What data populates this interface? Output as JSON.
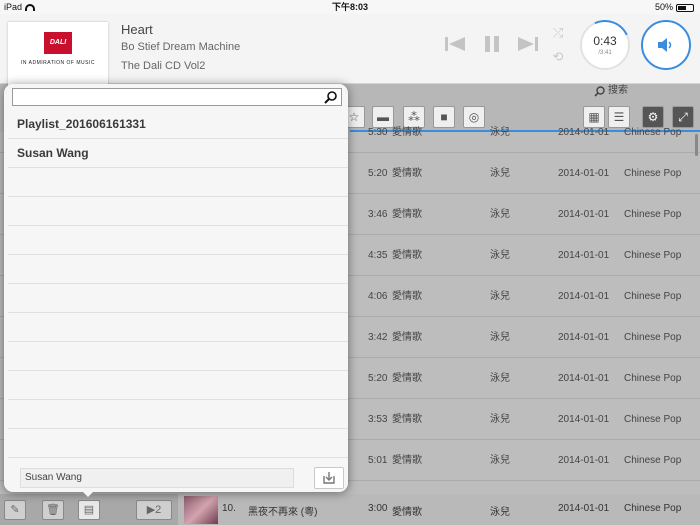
{
  "statusbar": {
    "device": "iPad",
    "time": "下午8:03",
    "battery": "50%"
  },
  "battery_level": 0.5,
  "nowplaying": {
    "title": "Heart",
    "artist": "Bo Stief Dream Machine",
    "album": "The Dali CD Vol2",
    "elapsed": "0:43",
    "total": "/3:41",
    "progress": 0.19
  },
  "logo": {
    "brand": "DALI",
    "tagline": "IN ADMIRATION OF MUSIC"
  },
  "toolbar": {
    "search_label": "搜索"
  },
  "popover": {
    "search_placeholder": "",
    "playlists": [
      {
        "name": "Playlist_201606161331"
      },
      {
        "name": "Susan Wang"
      },
      {
        "name": ""
      },
      {
        "name": ""
      },
      {
        "name": ""
      },
      {
        "name": ""
      },
      {
        "name": ""
      },
      {
        "name": ""
      },
      {
        "name": ""
      },
      {
        "name": ""
      },
      {
        "name": ""
      },
      {
        "name": ""
      }
    ],
    "name_field_value": "Susan Wang"
  },
  "tracks": [
    {
      "duration": "5:30",
      "title": "愛情歌",
      "artist": "泳兒",
      "date": "2014-01-01",
      "genre": "Chinese Pop"
    },
    {
      "duration": "5:20",
      "title": "愛情歌",
      "artist": "泳兒",
      "date": "2014-01-01",
      "genre": "Chinese Pop"
    },
    {
      "duration": "3:46",
      "title": "愛情歌",
      "artist": "泳兒",
      "date": "2014-01-01",
      "genre": "Chinese Pop"
    },
    {
      "duration": "4:35",
      "title": "愛情歌",
      "artist": "泳兒",
      "date": "2014-01-01",
      "genre": "Chinese Pop"
    },
    {
      "duration": "4:06",
      "title": "愛情歌",
      "artist": "泳兒",
      "date": "2014-01-01",
      "genre": "Chinese Pop"
    },
    {
      "duration": "3:42",
      "title": "愛情歌",
      "artist": "泳兒",
      "date": "2014-01-01",
      "genre": "Chinese Pop"
    },
    {
      "duration": "5:20",
      "title": "愛情歌",
      "artist": "泳兒",
      "date": "2014-01-01",
      "genre": "Chinese Pop"
    },
    {
      "duration": "3:53",
      "title": "愛情歌",
      "artist": "泳兒",
      "date": "2014-01-01",
      "genre": "Chinese Pop"
    },
    {
      "duration": "5:01",
      "title": "愛情歌",
      "artist": "泳兒",
      "date": "2014-01-01",
      "genre": "Chinese Pop"
    }
  ],
  "bottom_track": {
    "number": "10.",
    "title": "黑夜不再來 (粵)",
    "duration": "3:00",
    "title2": "愛情歌",
    "artist": "泳兒",
    "date": "2014-01-01",
    "genre": "Chinese Pop"
  },
  "bottombar": {
    "counter_label": "2"
  },
  "colors": {
    "accent": "#3a8dde",
    "brand": "#c8102e"
  }
}
